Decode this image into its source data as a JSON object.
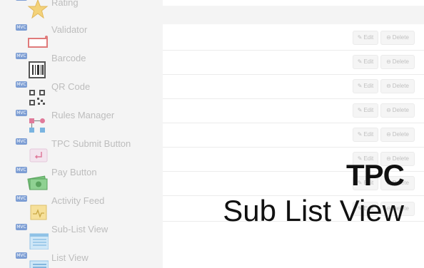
{
  "sidebar": {
    "badge": "MVC",
    "items": [
      {
        "label": "Rating",
        "icon": "star-icon"
      },
      {
        "label": "Validator",
        "icon": "validator-icon"
      },
      {
        "label": "Barcode",
        "icon": "barcode-icon"
      },
      {
        "label": "QR Code",
        "icon": "qr-code-icon"
      },
      {
        "label": "Rules Manager",
        "icon": "rules-manager-icon"
      },
      {
        "label": "TPC Submit Button",
        "icon": "submit-button-icon"
      },
      {
        "label": "Pay Button",
        "icon": "pay-button-icon"
      },
      {
        "label": "Activity Feed",
        "icon": "activity-feed-icon"
      },
      {
        "label": "Sub-List View",
        "icon": "sub-list-view-icon"
      },
      {
        "label": "List View",
        "icon": "list-view-icon"
      }
    ]
  },
  "list": {
    "edit_label": "Edit",
    "delete_label": "Delete"
  },
  "overlay": {
    "title": "TPC",
    "subtitle": "Sub List View"
  }
}
